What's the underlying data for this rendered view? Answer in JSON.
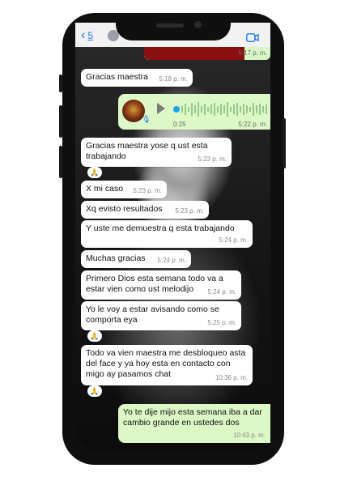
{
  "header": {
    "back_count": "5"
  },
  "prev_message": {
    "time": "5:17 p. m."
  },
  "voice_note": {
    "duration": "0:25",
    "time": "5:22 p. m."
  },
  "messages": [
    {
      "text": "Gracias maestra",
      "time": "5:18 p. m."
    },
    {
      "text": "Gracias maestra yose q ust esta trabajando",
      "time": "5:23 p. m.",
      "reaction": "🙏"
    },
    {
      "text": "X mi caso",
      "time": "5:23 p. m."
    },
    {
      "text": "Xq evisto resultados",
      "time": "5:23 p. m."
    },
    {
      "text": "Y uste me demuestra q esta trabajando",
      "time": "5:24 p. m."
    },
    {
      "text": "Muchas gracias",
      "time": "5:24 p. m."
    },
    {
      "text": "Primero Dios esta semana todo va a estar vien como ust melodijo",
      "time": "5:24 p. m."
    },
    {
      "text": "Yo le voy a estar avisando como se comporta eya",
      "time": "5:25 p. m.",
      "reaction": "🙏"
    },
    {
      "text": "Todo va vien maestra me desbloqueo asta del face y ya hoy esta en contacto con migo ay pasamos chat",
      "time": "10:36 p. m.",
      "reaction": "🙏"
    },
    {
      "text": "Yo te dije mijo esta semana iba a dar cambio grande en ustedes dos",
      "time": "10:43 p. m."
    }
  ]
}
